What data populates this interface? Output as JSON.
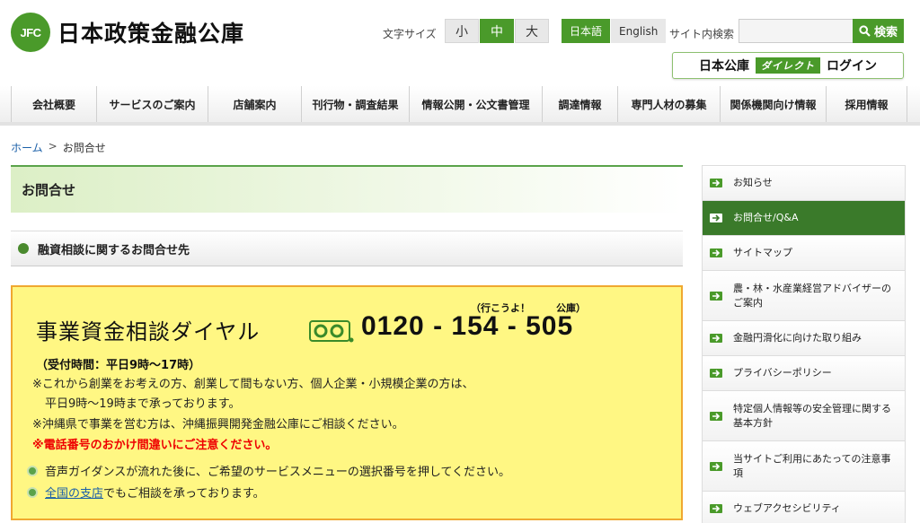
{
  "header": {
    "logo_mark": "JFC",
    "logo_text": "日本政策金融公庫",
    "fontsize_label": "文字サイズ",
    "fontsize_options": [
      "小",
      "中",
      "大"
    ],
    "languages": [
      "日本語",
      "English"
    ],
    "search_label": "サイト内検索",
    "search_value": "",
    "search_button": "検索",
    "direct_name": "日本公庫",
    "direct_badge": "ダイレクト",
    "direct_login": "ログイン"
  },
  "nav": {
    "items": [
      "会社概要",
      "サービスのご案内",
      "店舗案内",
      "刊行物・調査結果",
      "情報公開・公文書管理",
      "調達情報",
      "専門人材の募集",
      "関係機関向け情報",
      "採用情報"
    ]
  },
  "breadcrumb": {
    "home": "ホーム",
    "sep": ">",
    "current": "お問合せ"
  },
  "main": {
    "page_title": "お問合せ",
    "section_title": "融資相談に関するお問合せ先",
    "dial": {
      "title": "事業資金相談ダイヤル",
      "number": "0120 - 154 - 505",
      "ruby_1": "（行こうよ！",
      "ruby_2": "公庫）",
      "hours": "（受付時間：平日9時～17時）",
      "note_1": "※これから創業をお考えの方、創業して間もない方、個人企業・小規模企業の方は、",
      "note_1b": "平日9時～19時まで承っております。",
      "note_2": "※沖縄県で事業を営む方は、沖縄振興開発金融公庫にご相談ください。",
      "warning": "※電話番号のおかけ間違いにご注意ください。",
      "info_1": "音声ガイダンスが流れた後に、ご希望のサービスメニューの選択番号を押してください。",
      "info_2_link": "全国の支店",
      "info_2_rest": "でもご相談を承っております。"
    }
  },
  "sidenav": {
    "items": [
      {
        "label": "お知らせ"
      },
      {
        "label": "お問合せ/Q&A"
      },
      {
        "label": "サイトマップ"
      },
      {
        "label": "農・林・水産業経営アドバイザーの ご案内"
      },
      {
        "label": "金融円滑化に向けた取り組み"
      },
      {
        "label": "プライバシーポリシー"
      },
      {
        "label": "特定個人情報等の安全管理に関する 基本方針"
      },
      {
        "label": "当サイトご利用にあたっての注意事 項"
      },
      {
        "label": "ウェブアクセシビリティ"
      }
    ]
  },
  "colors": {
    "brand_green": "#4a9a2a",
    "active_side": "#3a7a2a",
    "dial_bg": "#fff783",
    "dial_border": "#f0a830",
    "warning": "#ee0000",
    "link": "#1a5fa8"
  }
}
